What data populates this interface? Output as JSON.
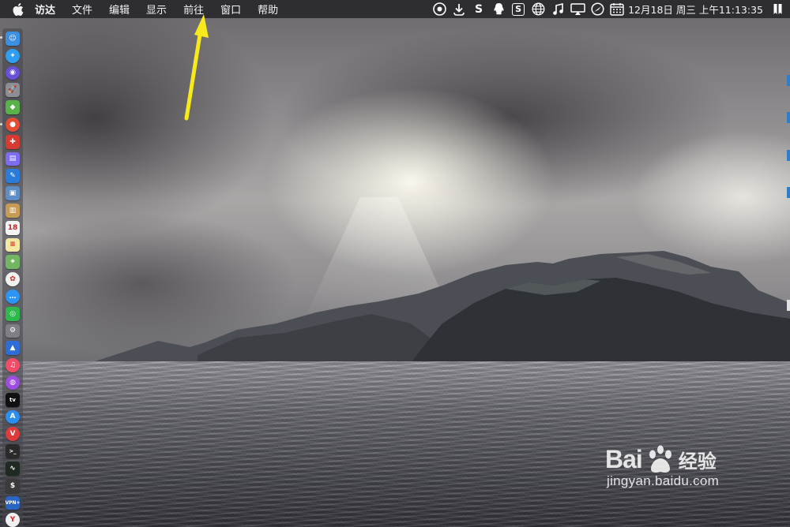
{
  "menubar": {
    "items": [
      "访达",
      "文件",
      "编辑",
      "显示",
      "前往",
      "窗口",
      "帮助"
    ],
    "datetime": "12月18日 周三 上午11:13:35",
    "status_icons": [
      "eye-icon",
      "download-icon",
      "s-app-icon",
      "qq-icon",
      "s-box-icon",
      "globe-icon",
      "music-note-icon",
      "airplay-icon",
      "compass-icon",
      "calendar-icon",
      "bookmark-icon"
    ],
    "status_glyphs": {
      "s": "S",
      "sbox": "S"
    }
  },
  "dock": {
    "apps": [
      {
        "name": "finder-icon",
        "color": "#3d8fe0",
        "glyph": "☺"
      },
      {
        "name": "safari-icon",
        "color": "#2f9ef0",
        "glyph": "✦"
      },
      {
        "name": "siri-icon",
        "color": "#6a4fd8",
        "glyph": "◉"
      },
      {
        "name": "launchpad-icon",
        "color": "#8d8d94",
        "glyph": "🚀"
      },
      {
        "name": "android-icon",
        "color": "#58b248",
        "glyph": "◆"
      },
      {
        "name": "chrome-icon",
        "color": "#e44c35",
        "glyph": "●"
      },
      {
        "name": "pin-app-icon",
        "color": "#d63a33",
        "glyph": "✚"
      },
      {
        "name": "disk-icon",
        "color": "#7d6cf0",
        "glyph": "▤"
      },
      {
        "name": "xcode-icon",
        "color": "#2b7bd8",
        "glyph": "✎"
      },
      {
        "name": "preview-icon",
        "color": "#5e8ec5",
        "glyph": "▣"
      },
      {
        "name": "contacts-icon",
        "color": "#c59b55",
        "glyph": "▥"
      },
      {
        "name": "calendar-icon",
        "color": "#f4f4f4",
        "glyph": "18"
      },
      {
        "name": "notes-icon",
        "color": "#f2e8a2",
        "glyph": "≡"
      },
      {
        "name": "maps-icon",
        "color": "#73b661",
        "glyph": "⌖"
      },
      {
        "name": "photos-icon",
        "color": "#f1f1f1",
        "glyph": "✿"
      },
      {
        "name": "messages-icon",
        "color": "#2d93f4",
        "glyph": "…"
      },
      {
        "name": "wechat-icon",
        "color": "#2fb84c",
        "glyph": "◎"
      },
      {
        "name": "system-preferences-icon",
        "color": "#7f7f86",
        "glyph": "⚙"
      },
      {
        "name": "keynote-icon",
        "color": "#2f6dd6",
        "glyph": "▲"
      },
      {
        "name": "music-icon",
        "color": "#f24c69",
        "glyph": "♫"
      },
      {
        "name": "podcasts-icon",
        "color": "#9d4ee0",
        "glyph": "◍"
      },
      {
        "name": "apple-tv-icon",
        "color": "#111111",
        "glyph": "tv"
      },
      {
        "name": "app-store-icon",
        "color": "#2c8ef0",
        "glyph": "A"
      },
      {
        "name": "vivaldi-icon",
        "color": "#e03b3b",
        "glyph": "V"
      },
      {
        "name": "terminal-icon",
        "color": "#2a2a2a",
        "glyph": ">_"
      },
      {
        "name": "activity-monitor-icon",
        "color": "#1f2a22",
        "glyph": "∿"
      },
      {
        "name": "console-icon",
        "color": "#3b3b3b",
        "glyph": "$"
      },
      {
        "name": "vpn-icon",
        "color": "#2b65c2",
        "glyph": "VPN+"
      },
      {
        "name": "yandex-icon",
        "color": "#f0f0f0",
        "glyph": "Y"
      }
    ]
  },
  "watermark": {
    "brand": "Bai",
    "brand_cn": "经验",
    "url": "jingyan.baidu.com"
  },
  "colors": {
    "arrow": "#f6ea1c",
    "menubar": "#26262a"
  }
}
